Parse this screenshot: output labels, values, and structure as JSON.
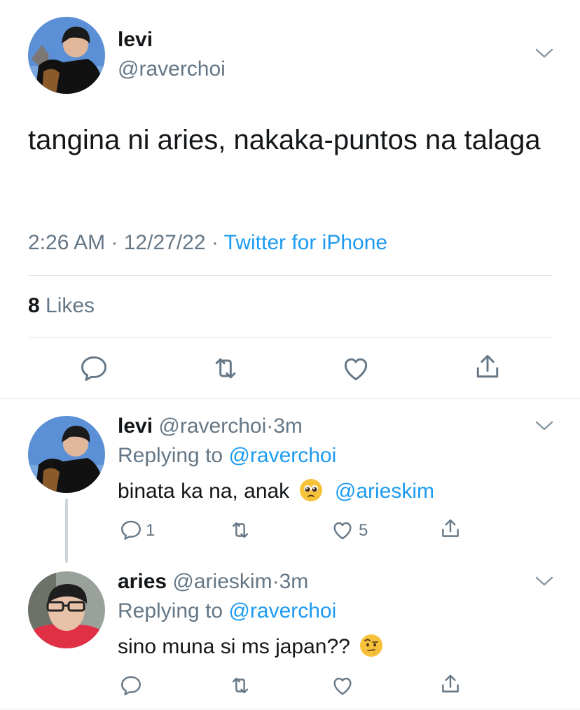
{
  "main_tweet": {
    "name": "levi",
    "handle": "@raverchoi",
    "text": "tangina ni aries, nakaka-puntos na talaga",
    "time": "2:26 AM",
    "dot1": " · ",
    "date": "12/27/22",
    "dot2": " · ",
    "source": "Twitter for iPhone",
    "likes_count": "8",
    "likes_label": " Likes",
    "icons": [
      "reply-icon",
      "retweet-icon",
      "like-icon",
      "share-icon"
    ]
  },
  "replies": [
    {
      "name": "levi",
      "handle": "@raverchoi",
      "time": "3m",
      "replying_label": "Replying to ",
      "replying_to": "@raverchoi",
      "text": "binata ka na, anak",
      "emoji": "pleading-face-emoji",
      "mention": "@arieskim",
      "reply_count": "1",
      "like_count": "5"
    },
    {
      "name": "aries",
      "handle": "@arieskim",
      "time": "3m",
      "replying_label": "Replying to ",
      "replying_to": "@raverchoi",
      "text": "sino muna si ms japan??",
      "emoji": "face-with-raised-eyebrow-emoji",
      "reply_count": "",
      "like_count": ""
    }
  ],
  "colors": {
    "link": "#1d9bf0",
    "secondary_text": "#657786",
    "divider": "#e1e8ed",
    "icon": "#657786"
  }
}
